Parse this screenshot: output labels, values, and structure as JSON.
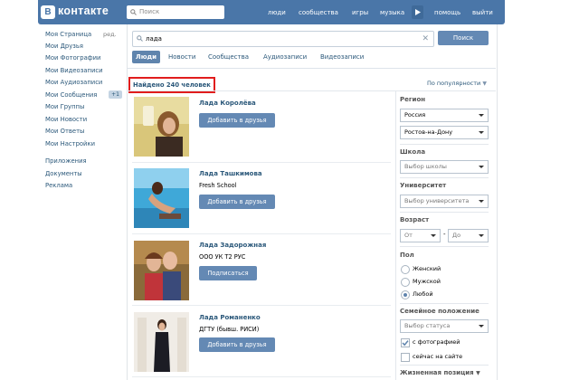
{
  "header": {
    "logo_letter": "В",
    "logo_text": "контакте",
    "search_placeholder": "Поиск",
    "nav": [
      "люди",
      "сообщества",
      "игры",
      "музыка",
      "помощь",
      "выйти"
    ]
  },
  "sidebar": {
    "edit_label": "ред.",
    "items": [
      "Моя Страница",
      "Мои Друзья",
      "Мои Фотографии",
      "Мои Видеозаписи",
      "Мои Аудиозаписи",
      "Мои Сообщения",
      "Мои Группы",
      "Мои Новости",
      "Мои Ответы",
      "Мои Настройки"
    ],
    "messages_badge": "+1",
    "extra": [
      "Приложения",
      "Документы",
      "Реклама"
    ]
  },
  "search": {
    "query": "лада",
    "button": "Поиск"
  },
  "tabs": [
    "Люди",
    "Новости",
    "Сообщества",
    "Аудиозаписи",
    "Видеозаписи"
  ],
  "results": {
    "count_label": "Найдено 240 человек",
    "sort_label": "По популярности",
    "people": [
      {
        "name": "Лада Королёва",
        "subtitle": "",
        "button": "Добавить в друзья"
      },
      {
        "name": "Лада Ташкимова",
        "subtitle": "Fresh School",
        "button": "Добавить в друзья"
      },
      {
        "name": "Лада Задорожная",
        "subtitle": "ООО УК Т2 РУС",
        "button": "Подписаться"
      },
      {
        "name": "Лада Романенко",
        "subtitle": "ДГТУ (бывш. РИСИ)",
        "button": "Добавить в друзья"
      }
    ]
  },
  "filters": {
    "region_label": "Регион",
    "country": "Россия",
    "city": "Ростов-на-Дону",
    "school_label": "Школа",
    "school_placeholder": "Выбор школы",
    "university_label": "Университет",
    "university_placeholder": "Выбор университета",
    "age_label": "Возраст",
    "age_from": "От",
    "age_dash": "-",
    "age_to": "До",
    "gender_label": "Пол",
    "gender_options": [
      "Женский",
      "Мужской",
      "Любой"
    ],
    "gender_selected": "Любой",
    "marital_label": "Семейное положение",
    "marital_placeholder": "Выбор статуса",
    "with_photo": "с фотографией",
    "online_now": "сейчас на сайте",
    "position_label": "Жизненная позиция"
  },
  "colors": {
    "brand": "#4a76a8",
    "button": "#6489b4",
    "link": "#2b587a",
    "highlight": "#e11d1d"
  }
}
